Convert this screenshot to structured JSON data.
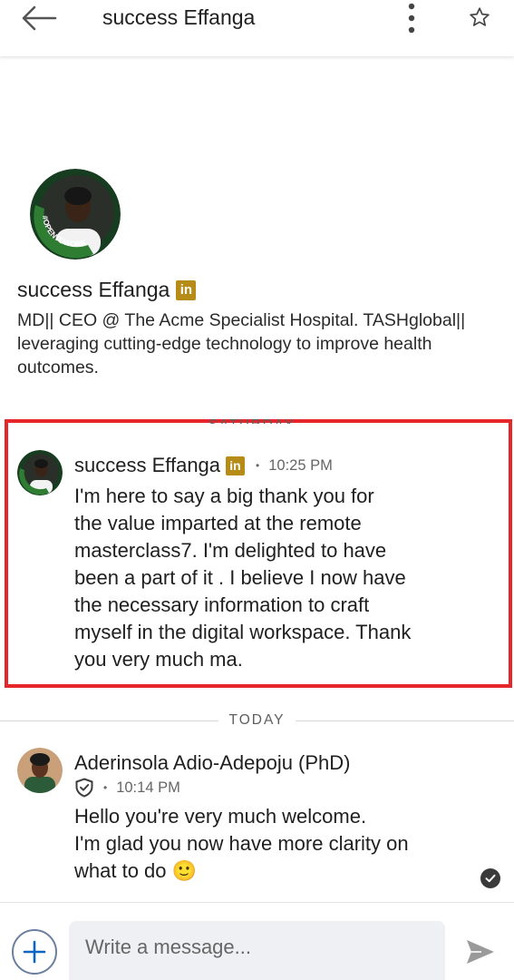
{
  "header": {
    "title": "success Effanga",
    "back_icon": "arrow-left-icon",
    "more_icon": "more-vertical-icon",
    "star_icon": "star-outline-icon"
  },
  "profile": {
    "name": "success Effanga",
    "badge": "in",
    "frame_text": "#OPENTOWORK",
    "headline": "MD|| CEO @ The Acme Specialist Hospital. TASHglobal|| leveraging cutting-edge technology to improve health outcomes."
  },
  "conversation": {
    "days": [
      {
        "label": "SATURDAY"
      },
      {
        "label": "TODAY"
      }
    ],
    "messages": [
      {
        "sender": "success Effanga",
        "badge": "in",
        "time": "10:25 PM",
        "text": "I'm here to say a big thank you for\nthe value imparted at the remote\nmasterclass7. I'm delighted to have\nbeen a part of it . I believe I now have\nthe necessary information to craft\nmyself in the digital workspace. Thank\nyou very much ma."
      },
      {
        "sender": "Aderinsola Adio-Adepoju (PhD)",
        "verified_icon": "shield-check-icon",
        "time": "10:14 PM",
        "text": "Hello you're very much welcome.\nI'm glad you now have more clarity on\nwhat to do 🙂"
      }
    ]
  },
  "composer": {
    "placeholder": "Write a message...",
    "value": ""
  },
  "colors": {
    "highlight_border": "#e5262b",
    "linkedin_badge": "#b78c16",
    "open_to_work_green": "#2e7d32"
  }
}
